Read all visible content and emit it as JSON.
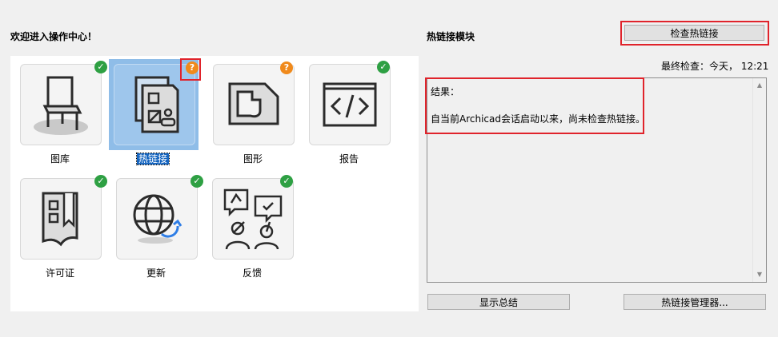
{
  "left": {
    "title": "欢迎进入操作中心！"
  },
  "tiles": [
    {
      "label": "图库",
      "status": "ok",
      "icon": "chair-icon"
    },
    {
      "label": "热链接",
      "status": "warn",
      "icon": "hotlink-document-icon",
      "selected": true
    },
    {
      "label": "图形",
      "status": "warn",
      "icon": "graphics-icon"
    },
    {
      "label": "报告",
      "status": "ok",
      "icon": "code-report-icon"
    },
    {
      "label": "许可证",
      "status": "ok",
      "icon": "license-icon"
    },
    {
      "label": "更新",
      "status": "ok",
      "icon": "globe-update-icon"
    },
    {
      "label": "反馈",
      "status": "ok",
      "icon": "feedback-people-icon"
    }
  ],
  "badges": {
    "ok": "✓",
    "warn": "?"
  },
  "right": {
    "title": "热链接模块",
    "check_button": "检查热链接",
    "last_check": "最终检查：今天， 12:21",
    "result_label": "结果：",
    "result_text": "自当前Archicad会话启动以来，尚未检查热链接。",
    "summary_button": "显示总结",
    "manager_button": "热链接管理器..."
  },
  "colors": {
    "ok": "#2ea043",
    "warn": "#f08a1c",
    "highlight": "#e0232b",
    "selection": "#8fbde8"
  }
}
